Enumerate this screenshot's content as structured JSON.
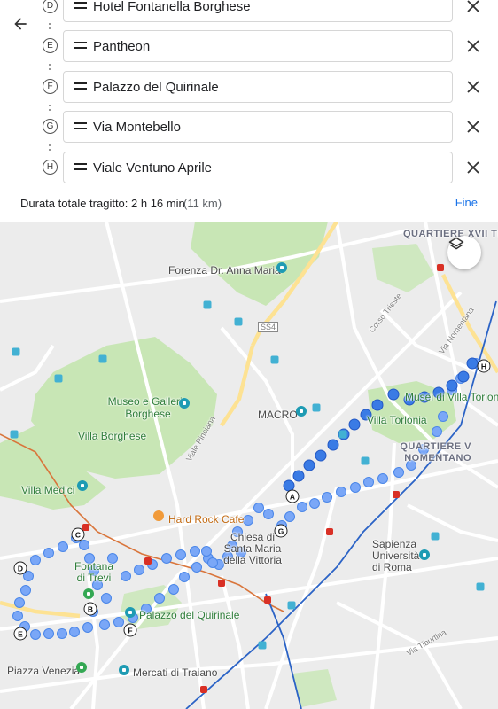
{
  "header": {
    "back_icon": "arrow-left-icon"
  },
  "stops": [
    {
      "letter": "D",
      "name": "Hotel Fontanella Borghese"
    },
    {
      "letter": "E",
      "name": "Pantheon"
    },
    {
      "letter": "F",
      "name": "Palazzo del Quirinale"
    },
    {
      "letter": "G",
      "name": "Via Montebello"
    },
    {
      "letter": "H",
      "name": "Viale Ventuno Aprile"
    }
  ],
  "summary": {
    "label": "Durata totale tragitto: 2 h 16 min",
    "distance": "(11 km)",
    "done": "Fine"
  },
  "map": {
    "labels": {
      "quartiere_xvii": "QUARTIERE XVII TRIES",
      "forenza": "Forenza Dr. Anna Maria",
      "ss4": "SS4",
      "corso_trieste": "Corso Trieste",
      "via_nomentana": "Via Nomentana",
      "museo_borghese": "Museo e Galleria Borghese",
      "macro": "MACRO",
      "musei_villa_torlonia": "Musei di Villa Torlonia",
      "villa_torlonia": "Villa Torlonia",
      "villa_borghese": "Villa Borghese",
      "viale_pinciana": "Viale Pinciana",
      "quartiere_v": "QUARTIERE V NOMENTANO",
      "villa_medici": "Villa Medici",
      "hard_rock": "Hard Rock Cafe",
      "chiesa": "Chiesa di Santa Maria della Vittoria",
      "sapienza": "Sapienza Università di Roma",
      "fontana": "Fontana di Trevi",
      "palazzo": "Palazzo del Quirinale",
      "piazza_venezia": "Piazza Venezia",
      "mercati": "Mercati di Traiano",
      "via_tiburtina": "Via Tiburtina"
    },
    "markers": [
      "A",
      "B",
      "C",
      "D",
      "E",
      "F",
      "G",
      "H"
    ],
    "layers_icon": "layers-icon"
  },
  "colors": {
    "accent": "#1a73e8",
    "route": "#4a8af4",
    "park": "#c8e6b5",
    "road": "#fde293"
  }
}
